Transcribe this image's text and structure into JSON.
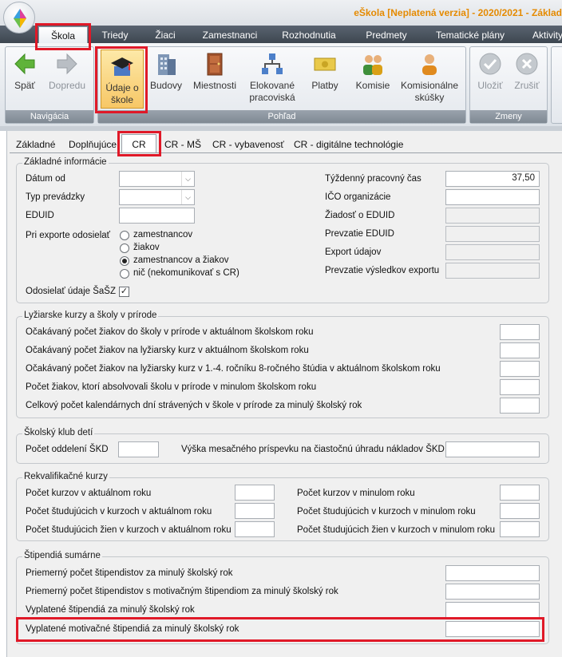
{
  "window": {
    "title": "eŠkola [Neplatená verzia] - 2020/2021 - Základ"
  },
  "menu_tabs": [
    "Škola",
    "Triedy",
    "Žiaci",
    "Zamestnanci",
    "Rozhodnutia",
    "Predmety",
    "Tematické plány",
    "Aktivity"
  ],
  "ribbon": {
    "navigation": {
      "caption": "Navigácia",
      "back": "Späť",
      "forward": "Dopredu"
    },
    "view": {
      "caption": "Pohľad",
      "school_data_1": "Údaje o",
      "school_data_2": "škole",
      "buildings": "Budovy",
      "rooms": "Miestnosti",
      "detached_1": "Elokované",
      "detached_2": "pracoviská",
      "payments": "Platby",
      "commissions": "Komisie",
      "commission_exams_1": "Komisionálne",
      "commission_exams_2": "skúšky"
    },
    "changes": {
      "caption": "Zmeny",
      "save": "Uložiť",
      "cancel": "Zrušiť"
    }
  },
  "sub_tabs": [
    "Základné",
    "Doplňujúce",
    "CR",
    "CR - MŠ",
    "CR - vybavenosť",
    "CR - digitálne technológie"
  ],
  "basic_info": {
    "legend": "Základné informácie",
    "date_from": "Dátum od",
    "operation_type": "Typ prevádzky",
    "eduid": "EDUID",
    "export_send": "Pri exporte odosielať",
    "options": [
      "zamestnancov",
      "žiakov",
      "zamestnancov a žiakov",
      "nič (nekomunikovať s CR)"
    ],
    "selected_option": "zamestnancov a žiakov",
    "send_sasz": "Odosielať údaje ŠaŠZ",
    "weekly_hours": "Týždenný pracovný čas",
    "weekly_hours_value": "37,50",
    "ico": "IČO organizácie",
    "eduid_request": "Žiadosť o EDUID",
    "eduid_takeover": "Prevzatie EDUID",
    "data_export": "Export údajov",
    "export_results": "Prevzatie výsledkov exportu"
  },
  "ski": {
    "legend": "Lyžiarske kurzy a školy v prírode",
    "rows": [
      "Očakávaný počet žiakov do školy v prírode v aktuálnom školskom roku",
      "Očakávaný počet žiakov na lyžiarsky kurz v aktuálnom školskom roku",
      "Očakávaný počet žiakov na lyžiarsky kurz v 1.-4. ročníku 8-ročného štúdia v aktuálnom školskom roku",
      "Počet žiakov, ktorí absolvovali školu v prírode v minulom školskom roku",
      "Celkový počet kalendárnych dní strávených v škole v prírode za minulý školský rok"
    ]
  },
  "skd": {
    "legend": "Školský klub detí",
    "departments": "Počet oddelení ŠKD",
    "fee": "Výška mesačného príspevku na čiastočnú úhradu nákladov ŠKD"
  },
  "requal": {
    "legend": "Rekvalifikačné kurzy",
    "left": [
      "Počet kurzov v aktuálnom roku",
      "Počet študujúcich v kurzoch v aktuálnom roku",
      "Počet študujúcich žien v kurzoch v aktuálnom roku"
    ],
    "right": [
      "Počet kurzov v minulom roku",
      "Počet študujúcich v kurzoch v minulom roku",
      "Počet študujúcich žien v kurzoch v minulom roku"
    ]
  },
  "scholar": {
    "legend": "Štipendiá sumárne",
    "rows": [
      "Priemerný počet štipendistov za minulý školský rok",
      "Priemerný počet štipendistov s motivačným štipendiom za minulý školský rok",
      "Vyplatené štipendiá za minulý školský rok",
      "Vyplatené motivačné štipendiá za minulý školský rok"
    ]
  }
}
